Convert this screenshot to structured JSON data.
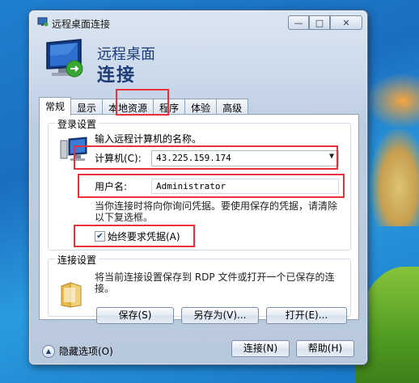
{
  "window": {
    "title": "远程桌面连接",
    "hero_line1": "远程桌面",
    "hero_line2": "连接",
    "minimize_glyph": "—",
    "maximize_glyph": "□",
    "close_glyph": "✕"
  },
  "tabs": [
    {
      "label": "常规",
      "active": true
    },
    {
      "label": "显示"
    },
    {
      "label": "本地资源"
    },
    {
      "label": "程序"
    },
    {
      "label": "体验"
    },
    {
      "label": "高级"
    }
  ],
  "login": {
    "group_title": "登录设置",
    "instruction": "输入远程计算机的名称。",
    "computer_label": "计算机(C):",
    "computer_value": "43.225.159.174",
    "username_label": "用户名:",
    "username_value": "Administrator",
    "note": "当你连接时将向你询问凭据。要使用保存的凭据，请清除以下复选框。",
    "always_ask_label": "始终要求凭据(A)",
    "always_ask_checked": true
  },
  "connection": {
    "group_title": "连接设置",
    "note": "将当前连接设置保存到 RDP 文件或打开一个已保存的连接。",
    "save_button": "保存(S)",
    "saveas_button": "另存为(V)...",
    "open_button": "打开(E)..."
  },
  "footer": {
    "hide_options": "隐藏选项(O)",
    "connect_button": "连接(N)",
    "help_button": "帮助(H)"
  },
  "colors": {
    "highlight": "#e8313b",
    "title_blue": "#1e3c78"
  },
  "icons": [
    "rdp-title-icon",
    "rdp-monitor-icon",
    "computer-icon",
    "folder-icon",
    "chevron-up-icon",
    "dropdown-arrow-icon",
    "check-icon"
  ]
}
